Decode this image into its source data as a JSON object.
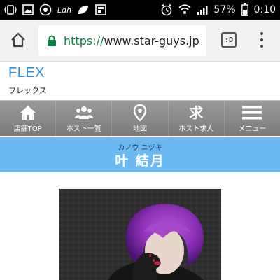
{
  "status_bar": {
    "battery": "57%",
    "time": "0:10",
    "icons": [
      "vibrate-icon",
      "image-icon",
      "app-icon",
      "lsh-icon",
      "leaf-icon",
      "flag-icon",
      "alarm-icon",
      "wifi-icon",
      "signal-icon",
      "battery-icon"
    ],
    "notification_text": "Ldh"
  },
  "browser": {
    "url_scheme": "https://",
    "url_host": "www.star-guys.jp",
    "tabs_label": ":D",
    "icons": [
      "home-icon",
      "lock-icon",
      "tabs-icon",
      "more-vert-icon"
    ]
  },
  "shop": {
    "name": "FLEX",
    "kana": "フレックス",
    "accent_color": "#2f8fd8"
  },
  "nav": {
    "items": [
      {
        "label": "店舗TOP",
        "icon": "home-icon"
      },
      {
        "label": "ホスト一覧",
        "icon": "people-icon"
      },
      {
        "label": "地図",
        "icon": "map-pin-icon"
      },
      {
        "label": "ホスト求人",
        "icon": "kyu-kanji-icon",
        "glyph": "求"
      },
      {
        "label": "メニュー",
        "icon": "hamburger-icon"
      }
    ]
  },
  "profile": {
    "reading": "カノウ ユヅキ",
    "name": "叶 結月",
    "banner_color": "#6cb8f0"
  }
}
